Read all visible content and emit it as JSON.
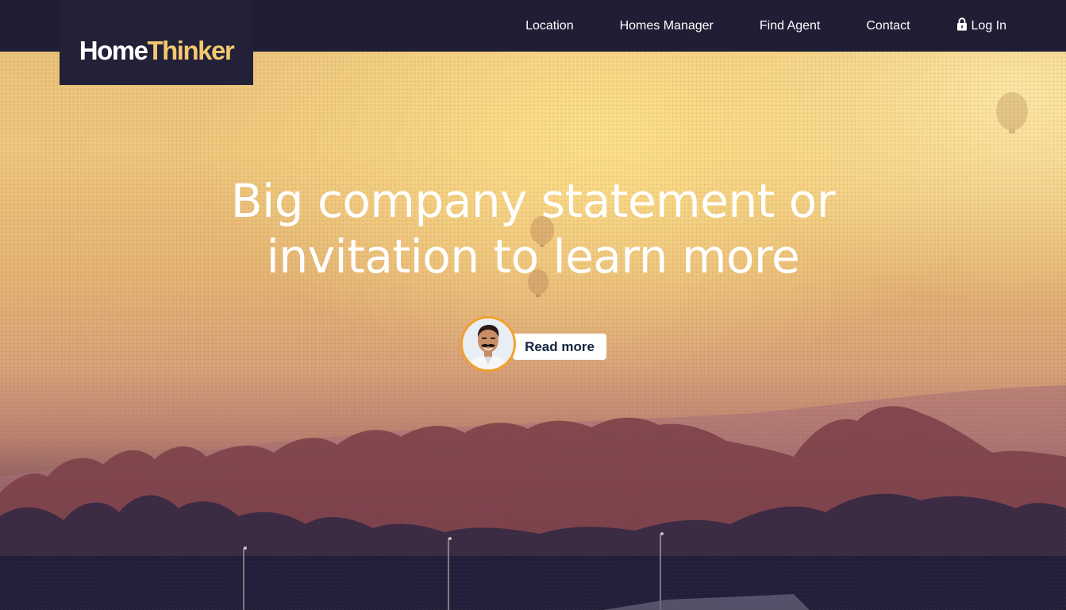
{
  "header": {
    "logo": {
      "part_a": "Home",
      "part_b": "Thinker"
    },
    "nav": [
      {
        "label": "Location"
      },
      {
        "label": "Homes Manager"
      },
      {
        "label": "Find Agent"
      },
      {
        "label": "Contact"
      },
      {
        "label": "Log In",
        "icon": "lock-icon"
      }
    ]
  },
  "hero": {
    "headline_line1": "Big company statement or",
    "headline_line2": "invitation to learn more",
    "cta": {
      "label": "Read more",
      "avatar": "person-avatar"
    }
  },
  "colors": {
    "topbar": "#201e35",
    "logo_accent": "#f4c870",
    "avatar_ring": "#f0a12c",
    "cta_text": "#14223c"
  }
}
